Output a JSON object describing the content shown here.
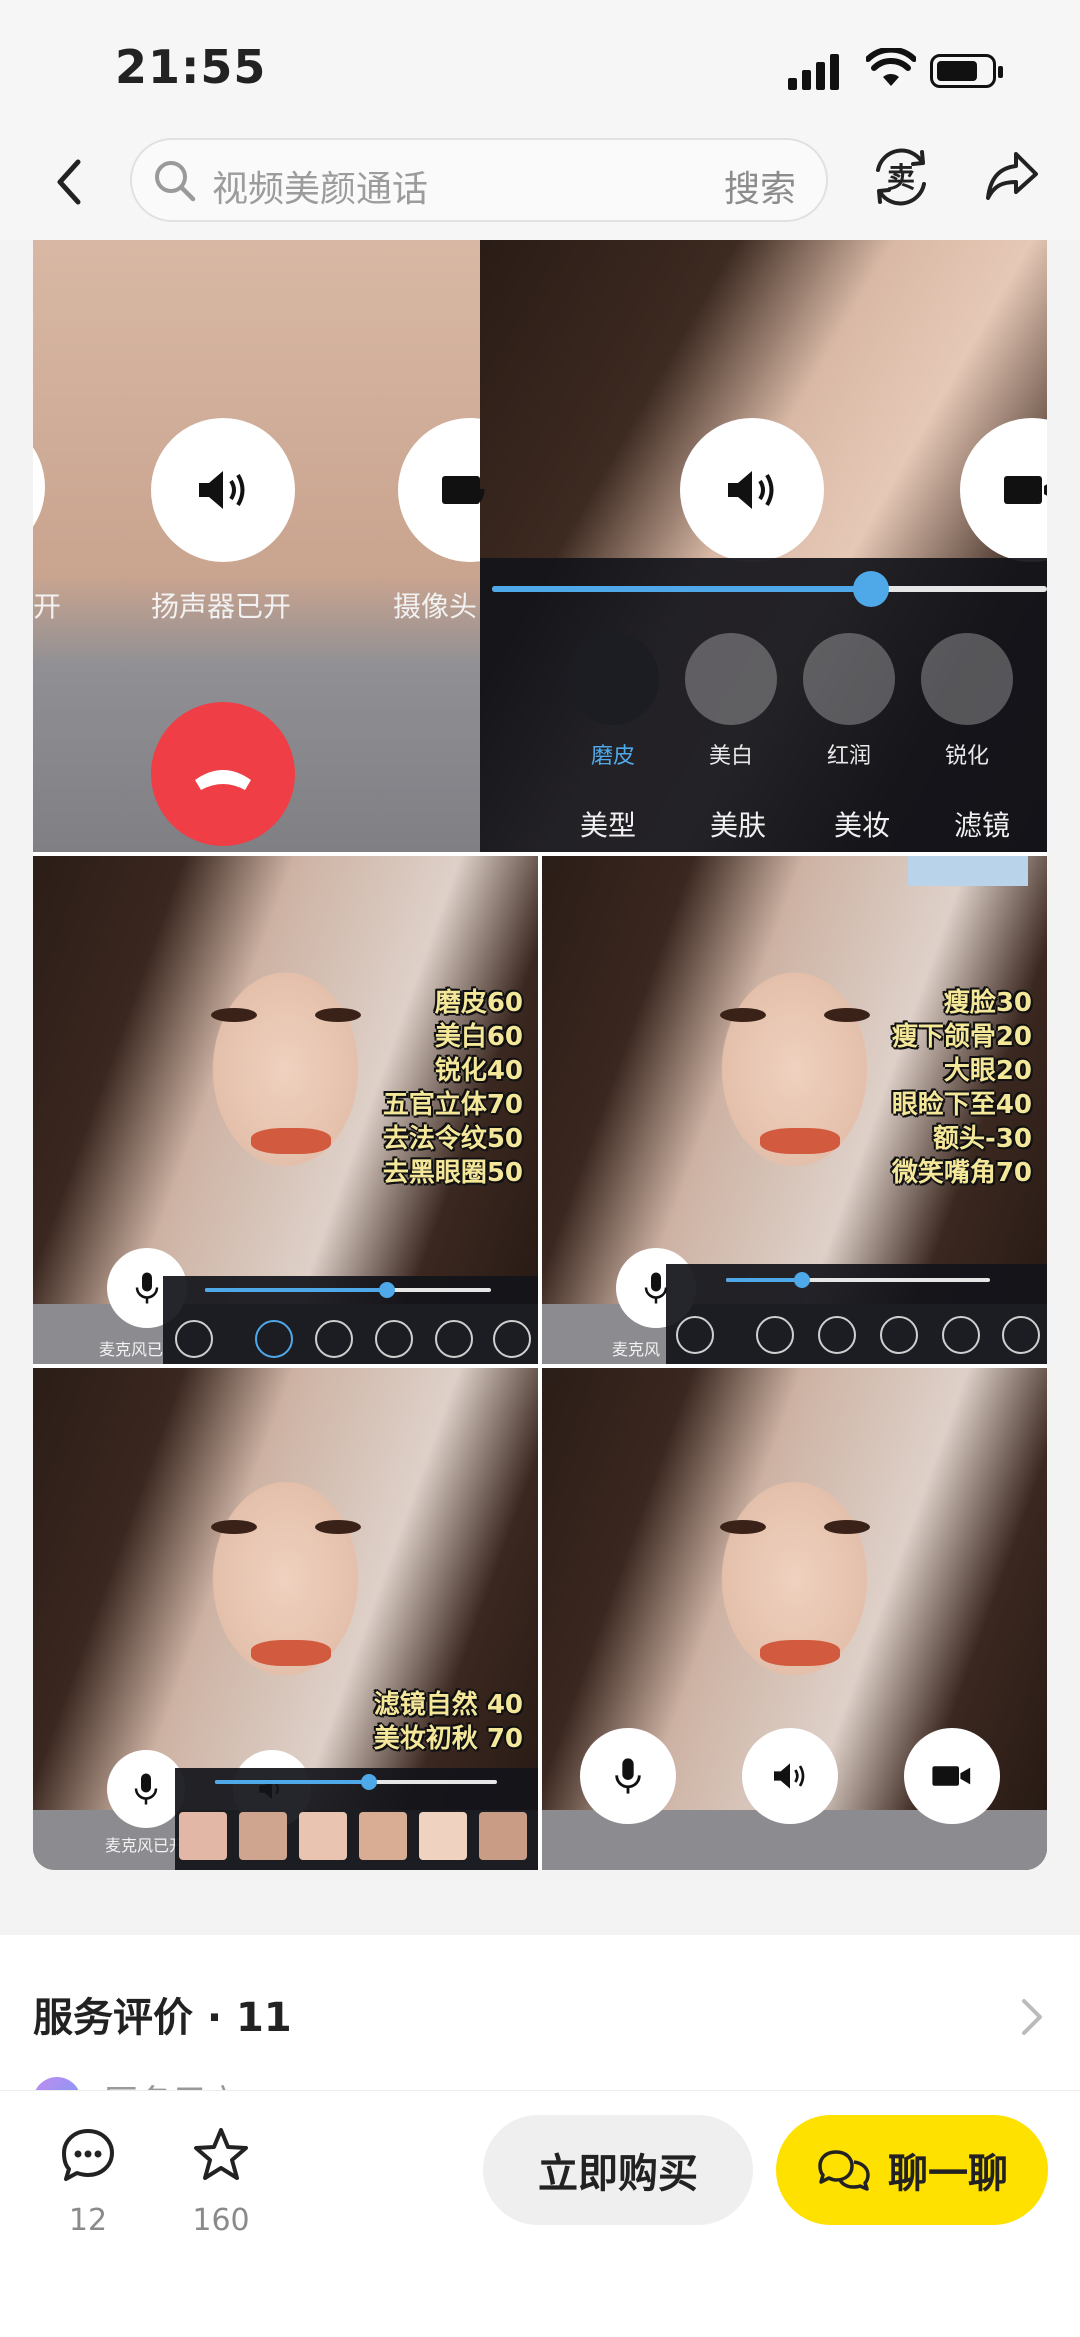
{
  "status_bar": {
    "time": "21:55"
  },
  "header": {
    "search_placeholder": "视频美颜通话",
    "search_button": "搜索"
  },
  "gallery": {
    "tile1": {
      "speaker_label": "扬声器已开",
      "camera_label": "摄像头",
      "left_partial": "开"
    },
    "tile2": {
      "beauty_items": [
        "磨皮",
        "美白",
        "红润",
        "锐化"
      ],
      "tabs": [
        "美型",
        "美肤",
        "美妆",
        "滤镜"
      ],
      "slider_level": 0.68
    },
    "tile3": {
      "overlay": [
        "磨皮60",
        "美白60",
        "锐化40",
        "五官立体70",
        "去法令纹50",
        "去黑眼圈50"
      ],
      "mic_label": "麦克风已"
    },
    "tile4": {
      "overlay": [
        "瘦脸30",
        "瘦下颌骨20",
        "大眼20",
        "眼睑下至40",
        "额头-30",
        "微笑嘴角70"
      ],
      "mic_label": "麦克风"
    },
    "tile5": {
      "overlay": [
        "滤镜自然  40",
        "美妆初秋  70"
      ],
      "mic_label": "麦克风已开"
    }
  },
  "reviews": {
    "title": "服务评价 · 11",
    "first_user": "匿名用户"
  },
  "bottom_bar": {
    "comments_count": "12",
    "favorites_count": "160",
    "buy_label": "立即购买",
    "chat_label": "聊一聊"
  },
  "colors": {
    "accent_yellow": "#ffe100",
    "slider_blue": "#4fa8e8",
    "hangup_red": "#ef3e45"
  }
}
